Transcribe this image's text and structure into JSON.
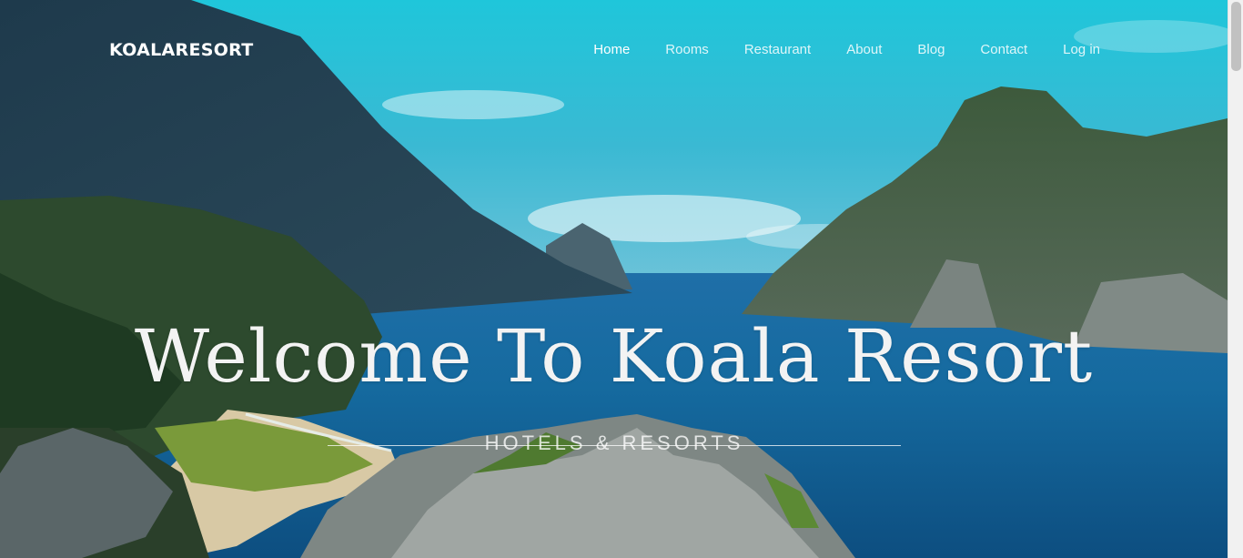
{
  "brand": {
    "name": "KOALARESORT"
  },
  "nav": {
    "items": [
      {
        "label": "Home",
        "active": true
      },
      {
        "label": "Rooms",
        "active": false
      },
      {
        "label": "Restaurant",
        "active": false
      },
      {
        "label": "About",
        "active": false
      },
      {
        "label": "Blog",
        "active": false
      },
      {
        "label": "Contact",
        "active": false
      },
      {
        "label": "Log in",
        "active": false
      }
    ]
  },
  "hero": {
    "title": "Welcome To Koala Resort",
    "subtitle": "HOTELS & RESORTS"
  },
  "colors": {
    "text": "#ffffff",
    "sky": "#22c4d8",
    "sea": "#145e92"
  }
}
